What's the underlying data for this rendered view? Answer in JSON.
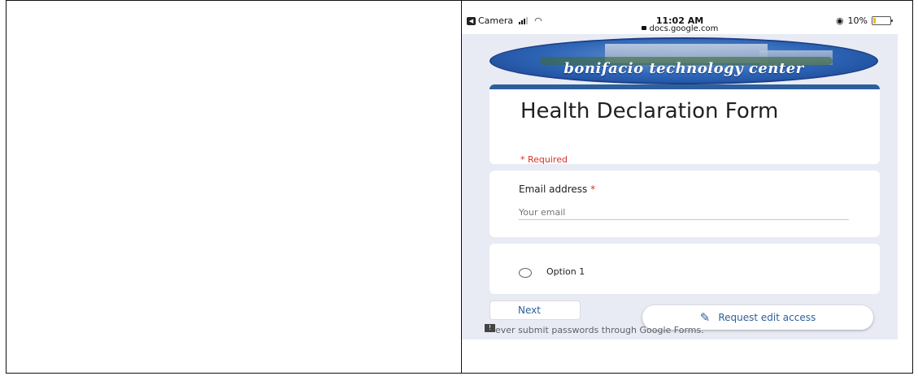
{
  "status_bar": {
    "back_app": "Camera",
    "time": "11:02 AM",
    "url": "docs.google.com",
    "battery": "10%"
  },
  "banner": {
    "text": "bonifacio technology center"
  },
  "form": {
    "title": "Health Declaration Form",
    "required_note": "* Required",
    "email_label": "Email address",
    "required_star": "*",
    "email_placeholder": "Your email",
    "option_label": "Option 1",
    "next_label": "Next",
    "edit_access_label": "Request edit access",
    "warning_text": "ever submit passwords through Google Forms."
  },
  "colors": {
    "accent": "#2d5f9c",
    "required": "#d93025",
    "background": "#e8ebf3"
  },
  "icons": [
    "back-icon",
    "signal-icon",
    "wifi-icon",
    "lock-icon",
    "alarm-icon",
    "battery-icon",
    "pencil-icon",
    "warning-icon",
    "radio-icon"
  ]
}
